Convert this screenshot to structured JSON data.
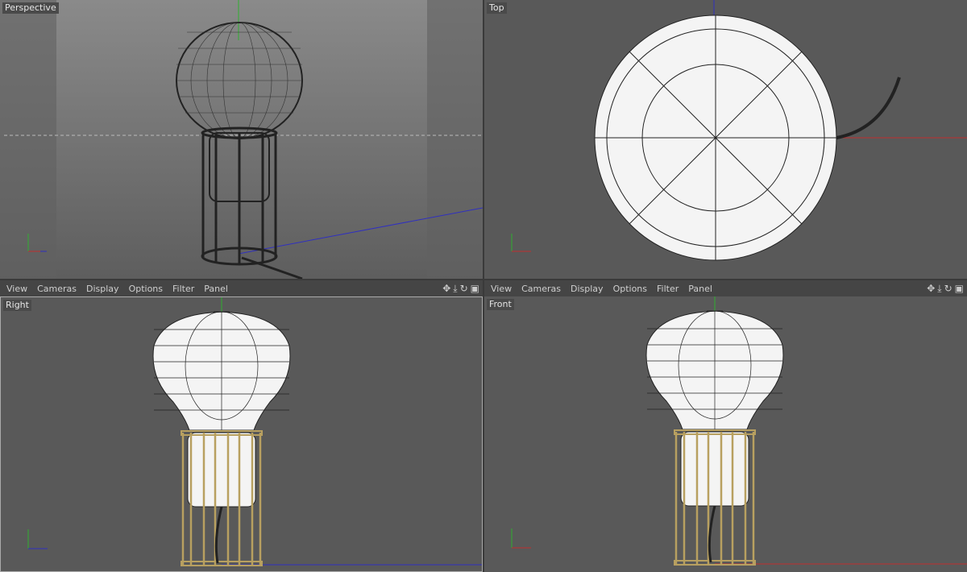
{
  "viewports": {
    "perspective": {
      "label": "Perspective"
    },
    "top": {
      "label": "Top"
    },
    "right": {
      "label": "Right"
    },
    "front": {
      "label": "Front"
    }
  },
  "menu": {
    "items": [
      "View",
      "Cameras",
      "Display",
      "Options",
      "Filter",
      "Panel"
    ]
  },
  "nav_icons": [
    "move-icon",
    "zoom-icon",
    "rotate-icon",
    "toggle-layout-icon"
  ],
  "colors": {
    "viewport_bg": "#595959",
    "x_axis": "#c03030",
    "y_axis": "#30b030",
    "z_axis": "#3030c0",
    "model": "#f4f4f4",
    "cage": "#b8a060"
  }
}
